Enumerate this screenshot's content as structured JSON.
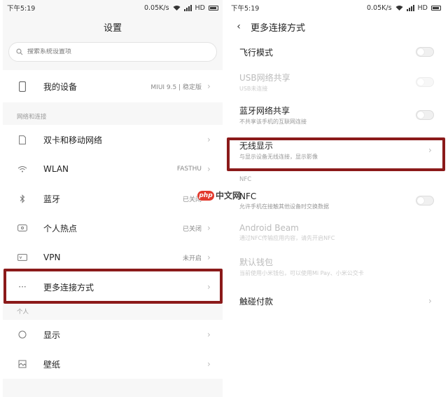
{
  "left": {
    "status": {
      "time": "下午5:19",
      "speed": "0.05K/s",
      "network": "HD"
    },
    "title": "设置",
    "search": {
      "placeholder": "搜索系统设置项"
    },
    "device": {
      "label": "我的设备",
      "value": "MIUI 9.5 | 稳定版"
    },
    "section_network": "网络和连接",
    "network_items": [
      {
        "label": "双卡和移动网络",
        "value": "",
        "icon": "sim-card-icon"
      },
      {
        "label": "WLAN",
        "value": "FASTHU",
        "icon": "wifi-icon"
      },
      {
        "label": "蓝牙",
        "value": "已关闭",
        "icon": "bluetooth-icon"
      },
      {
        "label": "个人热点",
        "value": "已关闭",
        "icon": "hotspot-icon"
      },
      {
        "label": "VPN",
        "value": "未开启",
        "icon": "vpn-icon"
      },
      {
        "label": "更多连接方式",
        "value": "",
        "icon": "more-icon"
      }
    ],
    "section_personal": "个人",
    "personal_items": [
      {
        "label": "显示",
        "icon": "display-icon"
      },
      {
        "label": "壁纸",
        "icon": "wallpaper-icon"
      }
    ]
  },
  "right": {
    "status": {
      "time": "下午5:19",
      "speed": "0.05K/s",
      "network": "HD"
    },
    "title": "更多连接方式",
    "items": [
      {
        "title": "飞行模式",
        "sub": "",
        "control": "toggle",
        "disabled": false
      },
      {
        "title": "USB网络共享",
        "sub": "USB未连接",
        "control": "toggle",
        "disabled": true
      },
      {
        "title": "蓝牙网络共享",
        "sub": "不共享该手机的互联网连接",
        "control": "toggle",
        "disabled": false
      },
      {
        "title": "无线显示",
        "sub": "与显示设备无线连接，显示影像",
        "control": "chevron",
        "disabled": false
      }
    ],
    "section_nfc": "NFC",
    "nfc_items": [
      {
        "title": "NFC",
        "sub": "允许手机在接触其他设备时交换数据",
        "control": "toggle",
        "disabled": false
      },
      {
        "title": "Android Beam",
        "sub": "通过NFC传输应用内容，请先开启NFC",
        "control": "none",
        "disabled": true
      },
      {
        "title": "默认钱包",
        "sub": "当前使用小米钱包，可以使用Mi Pay、小米公交卡",
        "control": "none",
        "disabled": true
      },
      {
        "title": "触碰付款",
        "sub": "",
        "control": "chevron",
        "disabled": false
      }
    ]
  },
  "watermark": {
    "logo": "php",
    "text": "中文网"
  },
  "colors": {
    "highlight": "#8b1a1a",
    "watermark_red": "#e23a2e"
  }
}
